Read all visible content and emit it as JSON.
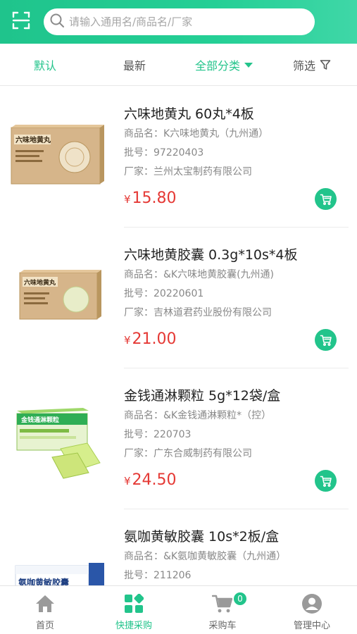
{
  "search": {
    "placeholder": "请输入通用名/商品名/厂家"
  },
  "filters": {
    "default": "默认",
    "newest": "最新",
    "category": "全部分类",
    "screen": "筛选"
  },
  "products": [
    {
      "name": "六味地黄丸 60丸*4板",
      "trade_name": "商品名：K六味地黄丸（九州通）",
      "batch": "批号：97220403",
      "maker": "厂家：兰州太宝制药有限公司",
      "currency": "¥",
      "price": "15.80",
      "box_text": "六味地黄丸"
    },
    {
      "name": "六味地黄胶囊 0.3g*10s*4板",
      "trade_name": "商品名：&K六味地黄胶囊(九州通)",
      "batch": "批号：20220601",
      "maker": "厂家：吉林道君药业股份有限公司",
      "currency": "¥",
      "price": "21.00",
      "box_text": "六味地黄丸"
    },
    {
      "name": "金钱通淋颗粒 5g*12袋/盒",
      "trade_name": "商品名：&K金钱通淋颗粒*（控）",
      "batch": "批号：220703",
      "maker": "厂家：广东合威制药有限公司",
      "currency": "¥",
      "price": "24.50",
      "box_text": "金钱通淋颗粒"
    },
    {
      "name": "氨咖黄敏胶囊 10s*2板/盒",
      "trade_name": "商品名：&K氨咖黄敏胶囊（九州通）",
      "batch": "批号：211206",
      "maker": "",
      "currency": "",
      "price": "",
      "box_text": "氨咖黄敏胶囊"
    }
  ],
  "tabs": [
    {
      "label": "首页"
    },
    {
      "label": "快捷采购"
    },
    {
      "label": "采购车",
      "badge": "0"
    },
    {
      "label": "管理中心"
    }
  ],
  "colors": {
    "accent": "#22c48b",
    "price": "#e53935"
  }
}
